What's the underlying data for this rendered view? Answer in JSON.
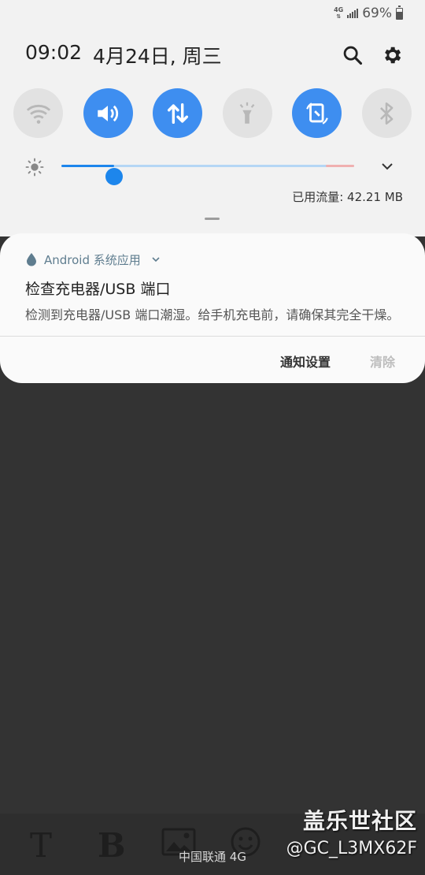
{
  "status": {
    "network_type": "4G",
    "battery_percent": "69%"
  },
  "header": {
    "time": "09:02",
    "date": "4月24日, 周三"
  },
  "toggles": [
    {
      "name": "wifi",
      "icon": "wifi-icon",
      "state": "off"
    },
    {
      "name": "sound",
      "icon": "sound-icon",
      "state": "on"
    },
    {
      "name": "mobile-data",
      "icon": "mobile-data-icon",
      "state": "on"
    },
    {
      "name": "flashlight",
      "icon": "flashlight-icon",
      "state": "off"
    },
    {
      "name": "auto-rotate",
      "icon": "auto-rotate-icon",
      "state": "on"
    },
    {
      "name": "bluetooth",
      "icon": "bluetooth-icon",
      "state": "off"
    }
  ],
  "brightness": {
    "level": 0.18
  },
  "data_usage": "已用流量: 42.21 MB",
  "notification": {
    "app_name": "Android 系统应用",
    "title": "检查充电器/USB 端口",
    "text": "检测到充电器/USB 端口潮湿。给手机充电前，请确保其完全干燥。",
    "settings_label": "通知设置",
    "clear_label": "清除"
  },
  "toolbar": {
    "text_label": "T",
    "bold_label": "B"
  },
  "carrier": "中国联通 4G",
  "watermark": {
    "site": "盖乐世社区",
    "user": "@GC_L3MX62F"
  },
  "colors": {
    "accent": "#3e8ef0",
    "panel_bg": "#f2f2f2",
    "dim_bg": "#333333"
  }
}
